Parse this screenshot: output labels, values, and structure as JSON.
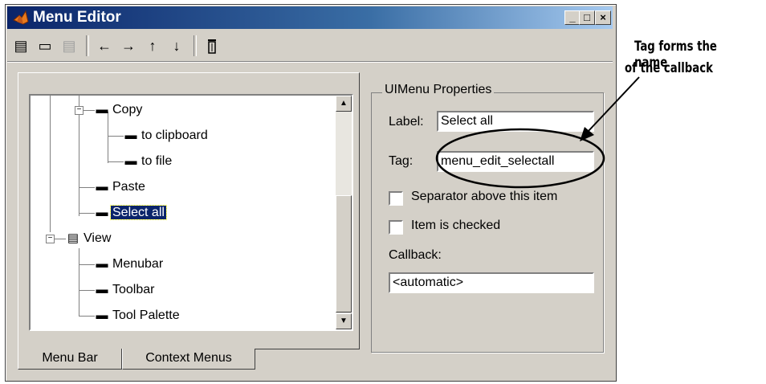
{
  "window": {
    "title": "Menu Editor",
    "title_buttons": [
      "_",
      "□",
      "×"
    ]
  },
  "toolbar": {
    "tools": [
      {
        "icon": "new-menu-icon",
        "glyph": "▤",
        "enabled": true
      },
      {
        "icon": "new-menu-item-icon",
        "glyph": "▭",
        "enabled": true
      },
      {
        "icon": "new-context-menu-icon",
        "glyph": "▤",
        "enabled": false
      },
      {
        "icon": "move-left-icon",
        "glyph": "←",
        "enabled": true
      },
      {
        "icon": "move-right-icon",
        "glyph": "→",
        "enabled": true
      },
      {
        "icon": "move-up-icon",
        "glyph": "↑",
        "enabled": true
      },
      {
        "icon": "move-down-icon",
        "glyph": "↓",
        "enabled": true
      },
      {
        "icon": "delete-icon",
        "glyph": "🗑",
        "enabled": true
      }
    ]
  },
  "tree": {
    "items": [
      {
        "label": "Copy",
        "level": 1,
        "type": "item",
        "expanded": true
      },
      {
        "label": "to clipboard",
        "level": 2,
        "type": "item"
      },
      {
        "label": "to file",
        "level": 2,
        "type": "item"
      },
      {
        "label": "Paste",
        "level": 1,
        "type": "item"
      },
      {
        "label": "Select all",
        "level": 1,
        "type": "item",
        "selected": true
      },
      {
        "label": "View",
        "level": 0,
        "type": "menu",
        "expanded": true
      },
      {
        "label": "Menubar",
        "level": 1,
        "type": "item"
      },
      {
        "label": "Toolbar",
        "level": 1,
        "type": "item"
      },
      {
        "label": "Tool Palette",
        "level": 1,
        "type": "item"
      }
    ]
  },
  "tabs": [
    {
      "label": "Menu Bar",
      "active": true
    },
    {
      "label": "Context Menus",
      "active": false
    }
  ],
  "properties": {
    "group_title": "UIMenu Properties",
    "label_label": "Label:",
    "label_value": "Select all",
    "tag_label": "Tag:",
    "tag_value": "menu_edit_selectall",
    "separator_label": "Separator above this item",
    "separator_checked": false,
    "checked_label": "Item is checked",
    "checked_checked": false,
    "callback_label": "Callback:",
    "callback_value": "<automatic>"
  },
  "annotation": {
    "line1": "Tag forms the name",
    "line2": "of the callback"
  },
  "colors": {
    "title_gradient_start": "#0a246a",
    "window_face": "#d4d0c8",
    "selection": "#0a246a"
  }
}
